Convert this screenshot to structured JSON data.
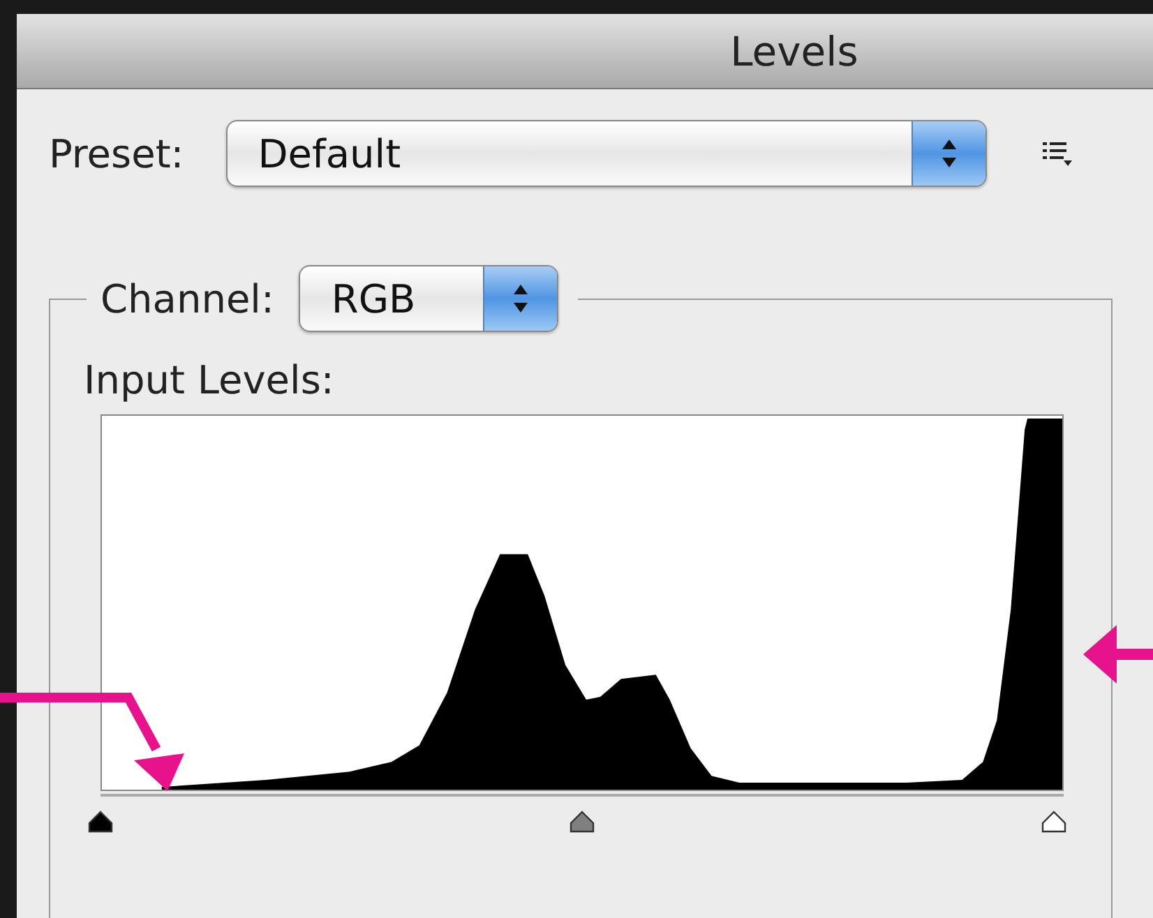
{
  "window": {
    "title": "Levels"
  },
  "preset": {
    "label": "Preset:",
    "value": "Default"
  },
  "channel": {
    "label": "Channel:",
    "value": "RGB"
  },
  "input_levels": {
    "label": "Input Levels:",
    "sliders": [
      {
        "kind": "black",
        "level": 0
      },
      {
        "kind": "gray",
        "level": 0.5
      },
      {
        "kind": "white",
        "level": 0.99
      }
    ]
  },
  "annotations": [
    {
      "kind": "bent-arrow"
    },
    {
      "kind": "left-arrow"
    }
  ]
}
